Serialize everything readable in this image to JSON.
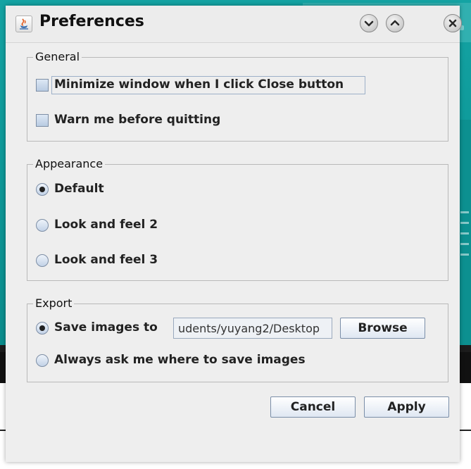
{
  "dialog": {
    "title": "Preferences",
    "window_controls": [
      "chevron-down-icon",
      "chevron-up-icon",
      "close-icon"
    ]
  },
  "general": {
    "legend": "General",
    "minimize_on_close": {
      "label": "Minimize window when I click Close button",
      "checked": false
    },
    "warn_before_quit": {
      "label": "Warn me before quitting",
      "checked": false
    }
  },
  "appearance": {
    "legend": "Appearance",
    "options": [
      {
        "label": "Default",
        "selected": true
      },
      {
        "label": "Look and feel 2",
        "selected": false
      },
      {
        "label": "Look and feel 3",
        "selected": false
      }
    ]
  },
  "export": {
    "legend": "Export",
    "save_images_to": {
      "label": "Save images to",
      "selected": true
    },
    "path_value": "udents/yuyang2/Desktop",
    "browse_label": "Browse",
    "always_ask": {
      "label": "Always ask me where to save images",
      "selected": false
    }
  },
  "footer": {
    "cancel_label": "Cancel",
    "apply_label": "Apply"
  },
  "colors": {
    "background_teal": "#0a8f8f",
    "dialog_bg": "#eeeeee",
    "button_border": "#7a8ea8"
  }
}
